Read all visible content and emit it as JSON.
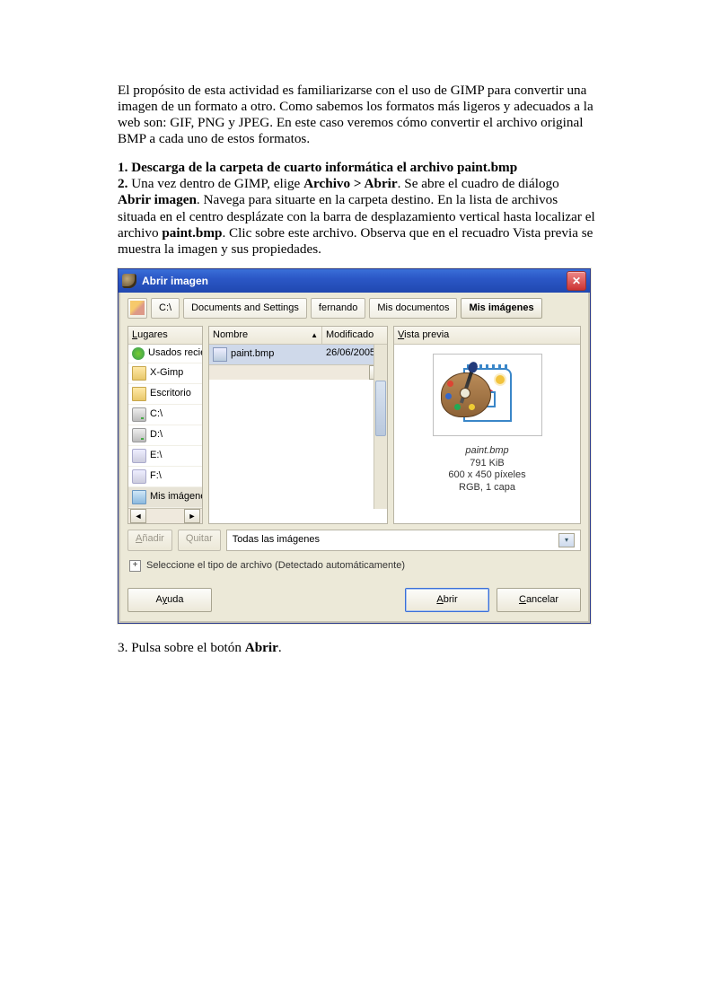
{
  "para_intro": "El propósito de esta actividad es familiarizarse con el uso de GIMP para convertir una imagen de un formato a otro. Como sabemos los formatos más ligeros y adecuados a la web son: GIF, PNG y JPEG. En este caso veremos cómo convertir el archivo original BMP a cada uno de estos formatos.",
  "step1_bold": "1. Descarga de la carpeta de cuarto informática el archivo paint.bmp",
  "step2_lead": "2.",
  "step2_a": " Una vez dentro de GIMP, elige ",
  "step2_menu": "Archivo > Abrir",
  "step2_b": ". Se abre el cuadro de diálogo ",
  "step2_dlg": "Abrir imagen",
  "step2_c": ". Navega para situarte en la carpeta destino. En la lista de archivos situada en el centro desplázate con la barra de desplazamiento vertical hasta localizar el archivo ",
  "step2_file": "paint.bmp",
  "step2_d": ". Clic sobre este archivo. Observa que en el recuadro Vista previa se muestra la imagen y sus propiedades.",
  "step3_a": "3. Pulsa sobre el botón ",
  "step3_b": "Abrir",
  "step3_c": ".",
  "dialog": {
    "title": "Abrir imagen",
    "breadcrumb": [
      "C:\\",
      "Documents and Settings",
      "fernando",
      "Mis documentos",
      "Mis imágenes"
    ],
    "places_header_prefix": "L",
    "places_header": "ugares",
    "places": [
      {
        "icon": "green",
        "label": "Usados recien"
      },
      {
        "icon": "folder",
        "label": "X-Gimp"
      },
      {
        "icon": "folder",
        "label": "Escritorio"
      },
      {
        "icon": "drive",
        "label": "C:\\"
      },
      {
        "icon": "drive",
        "label": "D:\\"
      },
      {
        "icon": "drivea",
        "label": "E:\\"
      },
      {
        "icon": "drivea",
        "label": "F:\\"
      },
      {
        "icon": "folder2",
        "label": "Mis imágenes",
        "selected": true
      }
    ],
    "col_name": "Nombre",
    "col_mod": "Modificado",
    "files": [
      {
        "name": "paint.bmp",
        "date": "26/06/2005",
        "selected": true
      }
    ],
    "preview_header_prefix": "V",
    "preview_header": "ista previa",
    "preview": {
      "filename": "paint.bmp",
      "size": "791 KiB",
      "dims": "600 x 450 píxeles",
      "mode": "RGB, 1 capa"
    },
    "btn_add": "Añadir",
    "btn_remove": "Quitar",
    "filter": "Todas las imágenes",
    "expander": "Seleccione el tipo de archivo (Detectado automáticamente)",
    "btn_help_prefix": "A",
    "btn_help_p2": "y",
    "btn_help": "uda",
    "btn_open_prefix": "A",
    "btn_open": "brir",
    "btn_cancel_prefix": "C",
    "btn_cancel": "ancelar"
  }
}
